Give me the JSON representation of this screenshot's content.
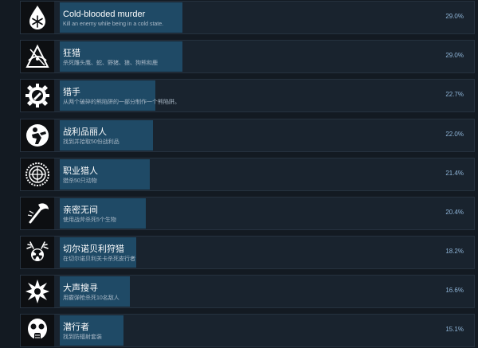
{
  "achievements": [
    {
      "title": "Cold-blooded murder",
      "description": "Kill an enemy while being in a cold state.",
      "percent_label": "29.0%",
      "percent": 29.0,
      "icon": "snowflake-drop-icon"
    },
    {
      "title": "狂猎",
      "description": "杀死雕头鹰、蛇、野猪、狼、狗熊和鹿",
      "percent_label": "29.0%",
      "percent": 29.0,
      "icon": "hunter-bow-icon"
    },
    {
      "title": "猎手",
      "description": "从两个破碎的熊陷阱的一部分制作一个熊陷阱。",
      "percent_label": "22.7%",
      "percent": 22.7,
      "icon": "trap-gear-icon"
    },
    {
      "title": "战利品丽人",
      "description": "找到并拾取50份战利品",
      "percent_label": "22.0%",
      "percent": 22.0,
      "icon": "loot-grab-icon"
    },
    {
      "title": "职业猎人",
      "description": "猎杀50只动物",
      "percent_label": "21.4%",
      "percent": 21.4,
      "icon": "crosshair-seal-icon"
    },
    {
      "title": "亲密无间",
      "description": "使用战斧杀死5个生物",
      "percent_label": "20.4%",
      "percent": 20.4,
      "icon": "axe-icon"
    },
    {
      "title": "切尔诺贝利狩猎",
      "description": "在切尔诺贝利关卡杀死皮行者",
      "percent_label": "18.2%",
      "percent": 18.2,
      "icon": "radiation-antlers-icon"
    },
    {
      "title": "大声搜寻",
      "description": "用霰弹枪杀死10名敌人",
      "percent_label": "16.6%",
      "percent": 16.6,
      "icon": "blast-icon"
    },
    {
      "title": "潜行者",
      "description": "找到防辐射套装",
      "percent_label": "15.1%",
      "percent": 15.1,
      "icon": "gas-mask-icon"
    }
  ]
}
